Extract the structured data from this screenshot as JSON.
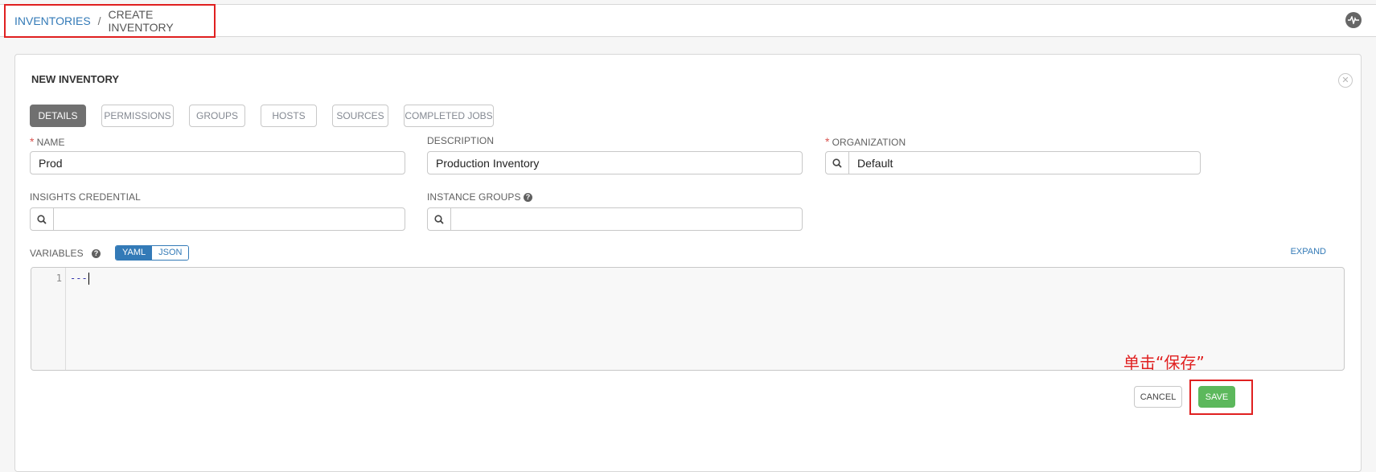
{
  "breadcrumb": {
    "parent": "INVENTORIES",
    "separator": "/",
    "current": "CREATE INVENTORY"
  },
  "header": {
    "activity_icon": "activity-stream-icon"
  },
  "panel": {
    "title": "NEW INVENTORY",
    "close_icon": "close-icon",
    "tabs": [
      {
        "label": "DETAILS",
        "active": true
      },
      {
        "label": "PERMISSIONS",
        "active": false
      },
      {
        "label": "GROUPS",
        "active": false
      },
      {
        "label": "HOSTS",
        "active": false
      },
      {
        "label": "SOURCES",
        "active": false
      },
      {
        "label": "COMPLETED JOBS",
        "active": false
      }
    ]
  },
  "form": {
    "name": {
      "label": "NAME",
      "required": true,
      "value": "Prod"
    },
    "description": {
      "label": "DESCRIPTION",
      "value": "Production Inventory"
    },
    "organization": {
      "label": "ORGANIZATION",
      "required": true,
      "value": "Default"
    },
    "insights_credential": {
      "label": "INSIGHTS CREDENTIAL",
      "value": ""
    },
    "instance_groups": {
      "label": "INSTANCE GROUPS",
      "value": ""
    },
    "variables": {
      "label": "VARIABLES",
      "modes": [
        "YAML",
        "JSON"
      ],
      "selected_mode": "YAML",
      "expand_label": "EXPAND",
      "line_numbers": [
        "1"
      ],
      "content": "---"
    }
  },
  "actions": {
    "cancel_label": "CANCEL",
    "save_label": "SAVE"
  },
  "annotation": {
    "text": "单击“保存”"
  },
  "colors": {
    "accent": "#337ab7",
    "save": "#5cb85c",
    "highlight": "#e02020",
    "active_tab": "#707070"
  }
}
